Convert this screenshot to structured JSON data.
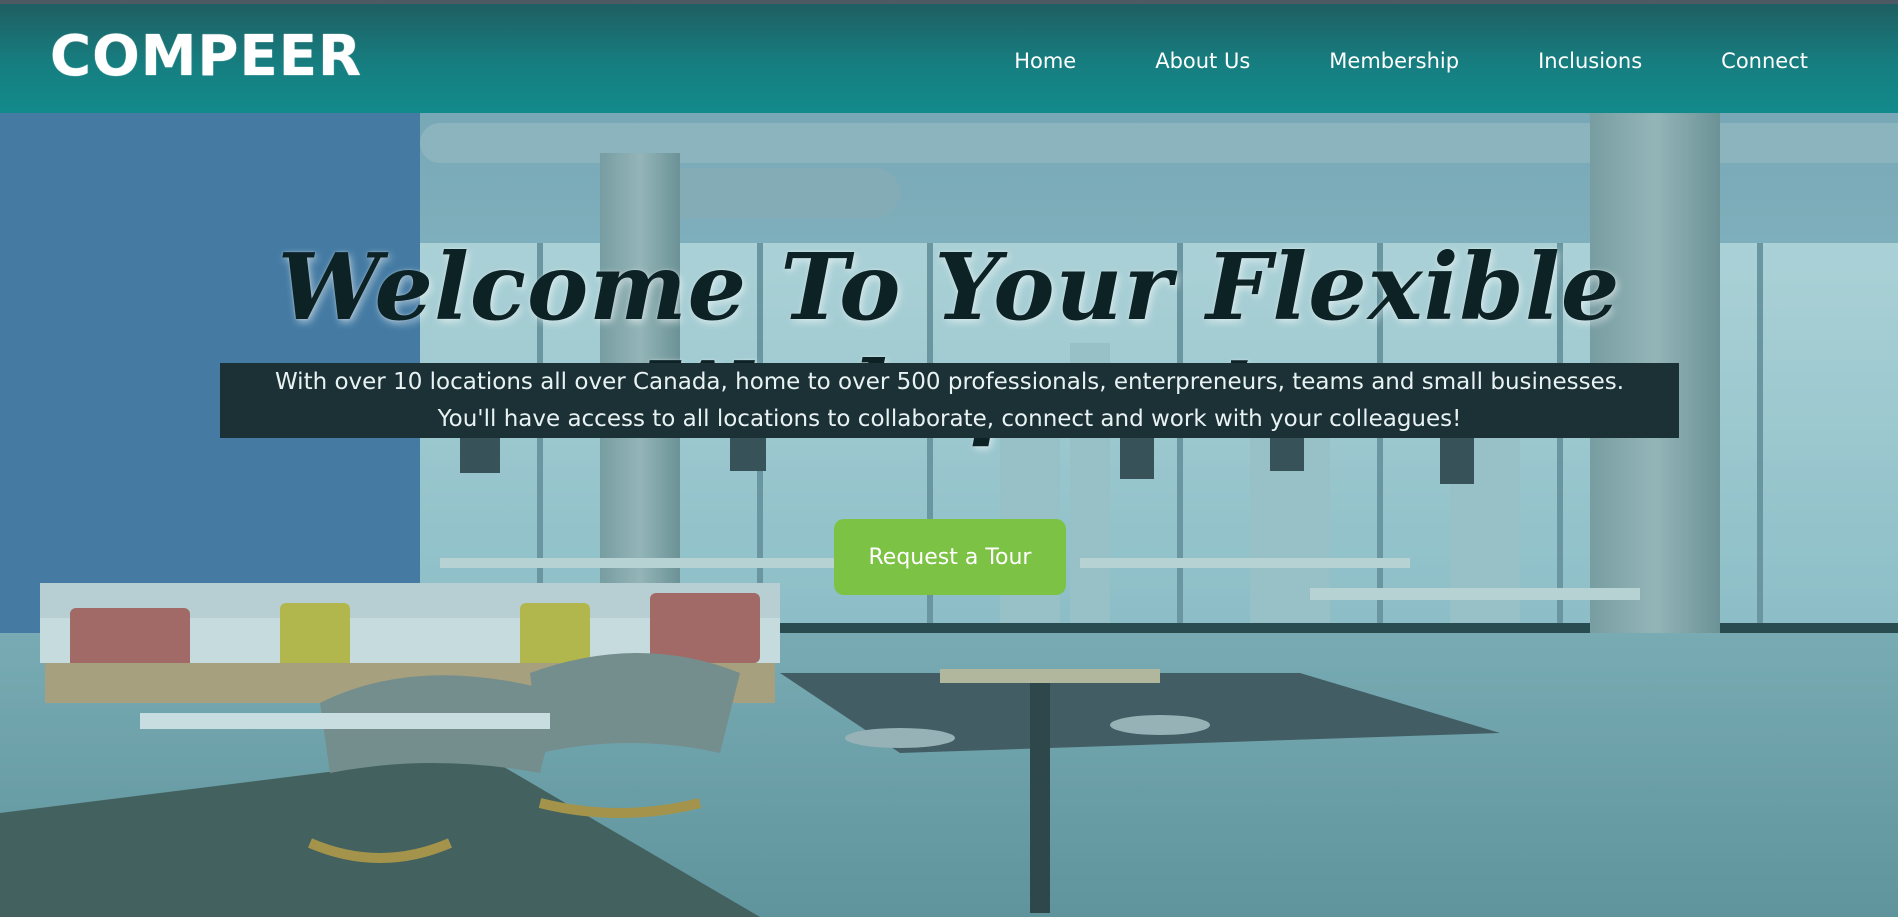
{
  "brand": {
    "logo_text": "COMPEER"
  },
  "nav": {
    "items": [
      {
        "label": "Home"
      },
      {
        "label": "About Us"
      },
      {
        "label": "Membership"
      },
      {
        "label": "Inclusions"
      },
      {
        "label": "Connect"
      }
    ]
  },
  "hero": {
    "headline": "Welcome To Your Flexible Workspace!",
    "subtitle_line1": "With over 10 locations all over Canada, home to over 500 professionals, enterpreneurs, teams and small businesses.",
    "subtitle_line2": "You'll have access to all locations to collaborate, connect and work with your colleagues!",
    "cta_label": "Request a Tour"
  },
  "colors": {
    "header": "#167e80",
    "cta": "#7cc244",
    "subtitle_box": "#1b3136",
    "headline": "#0c2225"
  }
}
